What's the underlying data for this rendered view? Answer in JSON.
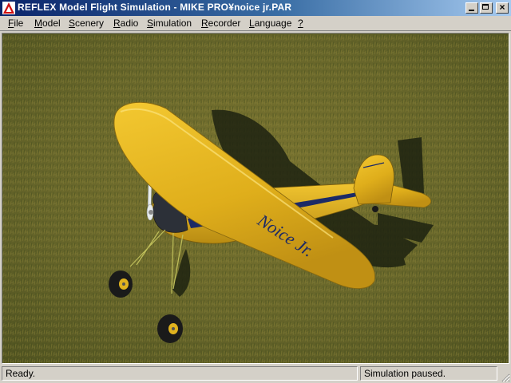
{
  "window": {
    "title": "REFLEX Model Flight Simulation - MIKE PRO¥noice jr.PAR"
  },
  "menu": [
    {
      "mnemonic": "F",
      "rest": "ile"
    },
    {
      "mnemonic": "M",
      "rest": "odel"
    },
    {
      "mnemonic": "S",
      "rest": "cenery"
    },
    {
      "mnemonic": "R",
      "rest": "adio"
    },
    {
      "mnemonic": "S",
      "rest": "imulation"
    },
    {
      "mnemonic": "R",
      "rest": "ecorder"
    },
    {
      "mnemonic": "L",
      "rest": "anguage"
    },
    {
      "mnemonic": "?",
      "rest": ""
    }
  ],
  "status": {
    "left": "Ready.",
    "right": "Simulation paused."
  },
  "aircraft": {
    "wing_text": "Noice Jr.",
    "body_color": "#e2b01a",
    "accent_color": "#1c2a66"
  },
  "colors": {
    "title_start": "#0a246a",
    "title_end": "#a6caf0",
    "grass": "#6b6a2a"
  }
}
